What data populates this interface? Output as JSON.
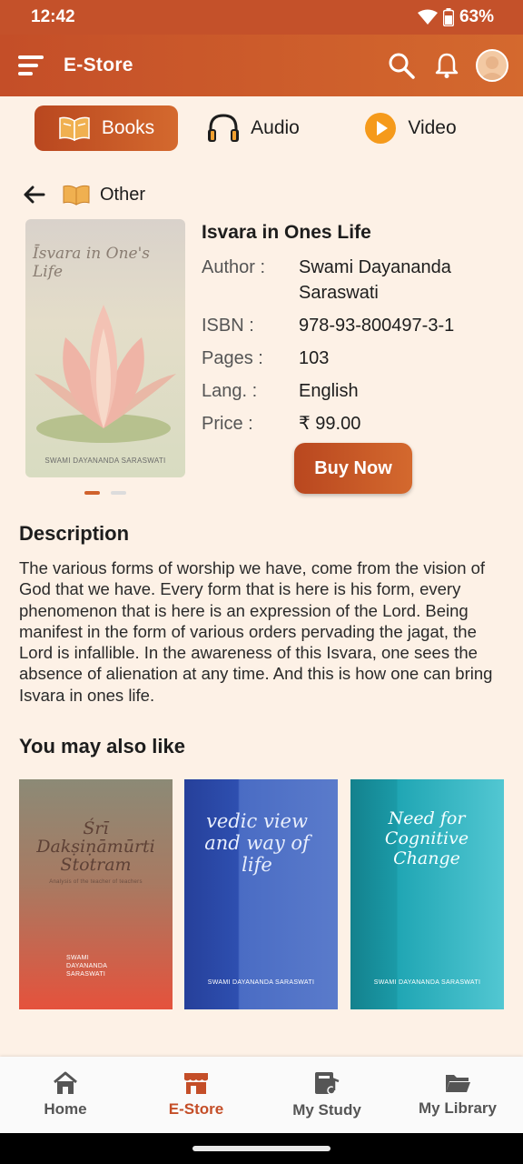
{
  "status": {
    "time": "12:42",
    "battery": "63%"
  },
  "appbar": {
    "title": "E-Store"
  },
  "media_tabs": [
    {
      "label": "Books",
      "icon": "book-icon",
      "active": true
    },
    {
      "label": "Audio",
      "icon": "headphones-icon",
      "active": false
    },
    {
      "label": "Video",
      "icon": "play-icon",
      "active": false
    }
  ],
  "breadcrumb": {
    "category": "Other"
  },
  "book": {
    "cover_title": "Īsvara in One's Life",
    "cover_author": "SWAMI DAYANANDA SARASWATI",
    "title": "Isvara in Ones Life",
    "details": [
      {
        "label": "Author :",
        "value": "Swami Dayananda Saraswati"
      },
      {
        "label": "ISBN :",
        "value": "978-93-800497-3-1"
      },
      {
        "label": "Pages :",
        "value": "103"
      },
      {
        "label": "Lang. :",
        "value": "English"
      },
      {
        "label": "Price :",
        "value": "₹ 99.00"
      }
    ],
    "buy_label": "Buy Now"
  },
  "description": {
    "heading": "Description",
    "text": "The various forms of worship we have, come from the vision of God that we have. Every form that is here is his form, every phenomenon that is here is an expression of the Lord. Being manifest in the form of various orders pervading the jagat, the Lord is infallible. In the awareness of this Isvara, one sees the absence of alienation at any time. And this is how one can bring Isvara in ones life."
  },
  "recommendations": {
    "heading": "You may also like",
    "items": [
      {
        "title": "Śrī Dakṣiṇāmūrti Stotram",
        "subtitle": "Analysis of the teacher of teachers",
        "author": "SWAMI DAYANANDA SARASWATI"
      },
      {
        "title": "vedic view and way of life",
        "author": "SWAMI DAYANANDA SARASWATI"
      },
      {
        "title": "Need for Cognitive Change",
        "author": "SWAMI DAYANANDA SARASWATI"
      }
    ]
  },
  "bottom_nav": [
    {
      "label": "Home",
      "icon": "home-icon",
      "active": false
    },
    {
      "label": "E-Store",
      "icon": "store-icon",
      "active": true
    },
    {
      "label": "My Study",
      "icon": "study-icon",
      "active": false
    },
    {
      "label": "My Library",
      "icon": "folder-icon",
      "active": false
    }
  ],
  "colors": {
    "accent": "#c44e28",
    "background": "#fdf1e6",
    "video_icon": "#f59a1b"
  }
}
